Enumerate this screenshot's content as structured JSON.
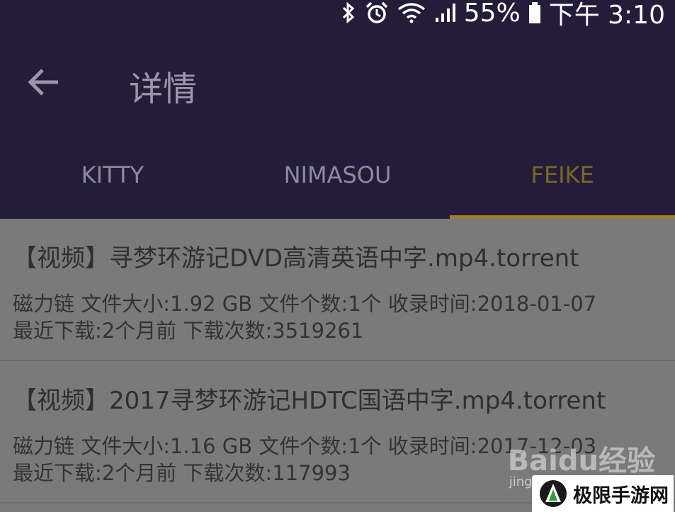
{
  "status_bar": {
    "battery": "55%",
    "time": "下午 3:10"
  },
  "header": {
    "title": "详情"
  },
  "tabs": [
    {
      "label": "KITTY",
      "active": false
    },
    {
      "label": "NIMASOU",
      "active": false
    },
    {
      "label": "FEIKE",
      "active": true
    }
  ],
  "results": [
    {
      "title": "【视频】寻梦环游记DVD高清英语中字.mp4.torrent",
      "line1": "磁力链 文件大小:1.92 GB 文件个数:1个 收录时间:2018-01-07",
      "line2": "最近下载:2个月前 下载次数:3519261"
    },
    {
      "title": "【视频】2017寻梦环游记HDTC国语中字.mp4.torrent",
      "line1": "磁力链 文件大小:1.16 GB 文件个数:1个 收录时间:2017-12-03",
      "line2": "最近下载:2个月前 下载次数:117993"
    }
  ],
  "watermark": {
    "text": "Baidu经验",
    "sub": "jingyan"
  },
  "site_logo": {
    "text": "极限手游网"
  },
  "colors": {
    "appbar": "#241d3a",
    "active_tab": "#a08030",
    "overlay_bg": "#7a7a7a"
  }
}
